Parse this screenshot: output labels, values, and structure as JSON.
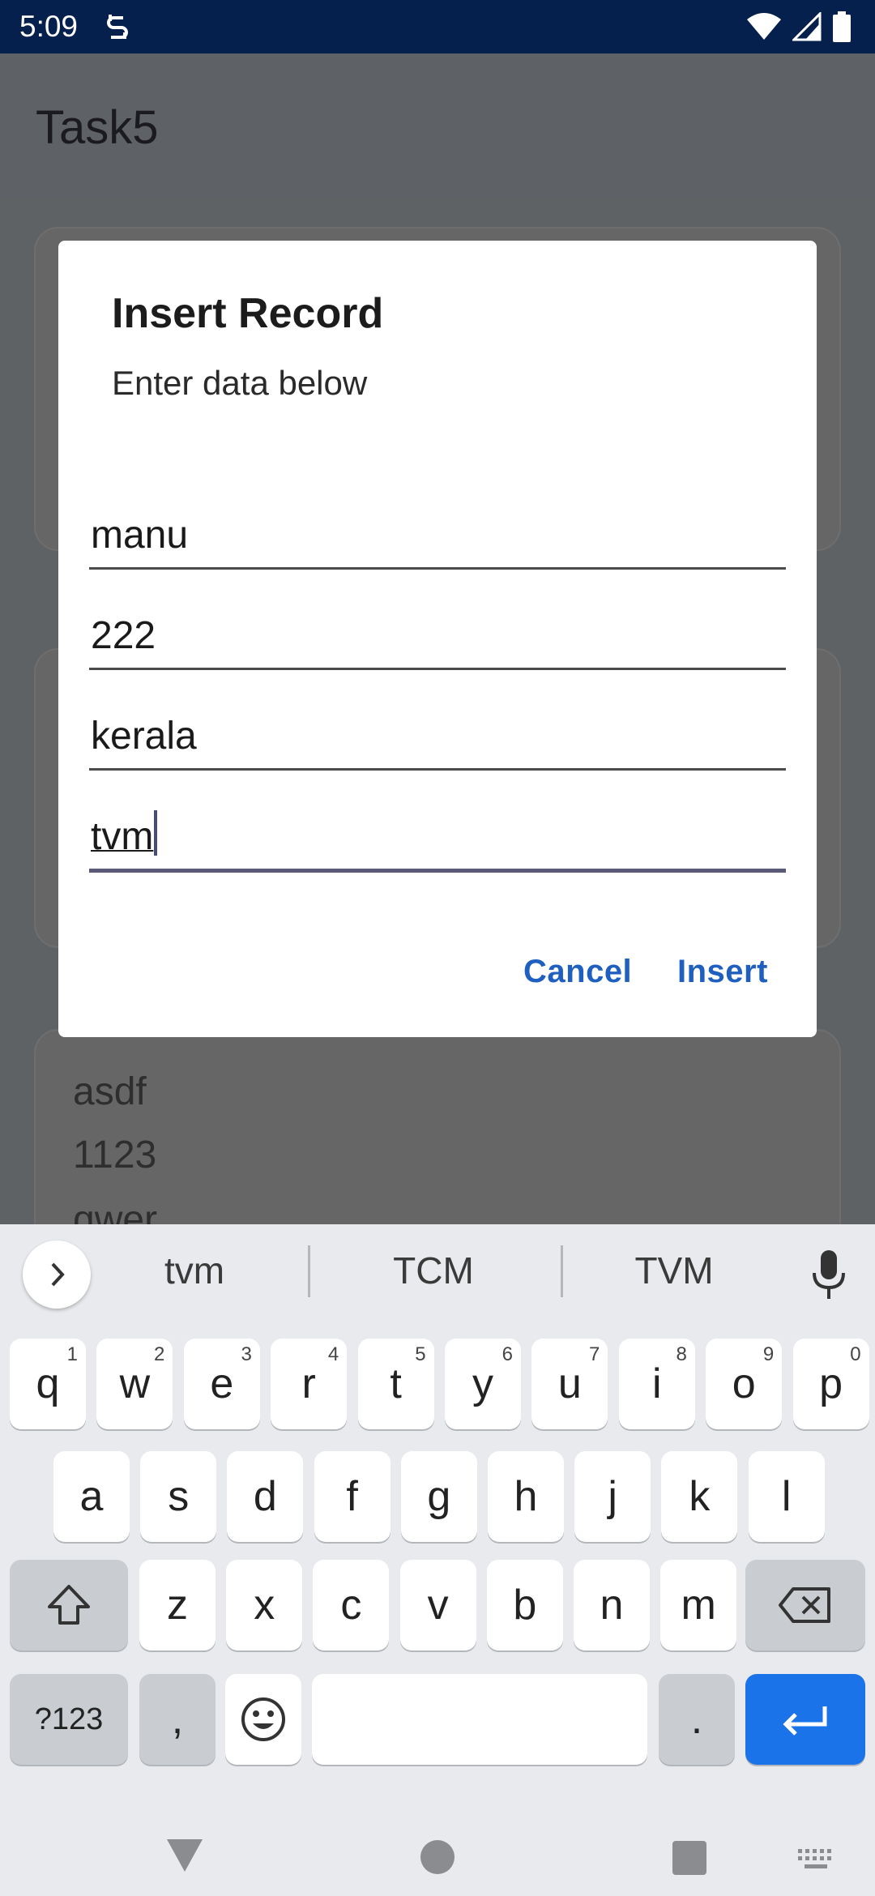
{
  "status": {
    "time": "5:09"
  },
  "app": {
    "title": "Task5"
  },
  "background": {
    "lines": [
      "asdf",
      "1123",
      "qwer"
    ]
  },
  "dialog": {
    "title": "Insert Record",
    "subtitle": "Enter data below",
    "fields": [
      "manu",
      "222",
      "kerala",
      "tvm"
    ],
    "cancel_label": "Cancel",
    "insert_label": "Insert"
  },
  "keyboard": {
    "suggestions": [
      "tvm",
      "TCM",
      "TVM"
    ],
    "row1": [
      {
        "k": "q",
        "h": "1"
      },
      {
        "k": "w",
        "h": "2"
      },
      {
        "k": "e",
        "h": "3"
      },
      {
        "k": "r",
        "h": "4"
      },
      {
        "k": "t",
        "h": "5"
      },
      {
        "k": "y",
        "h": "6"
      },
      {
        "k": "u",
        "h": "7"
      },
      {
        "k": "i",
        "h": "8"
      },
      {
        "k": "o",
        "h": "9"
      },
      {
        "k": "p",
        "h": "0"
      }
    ],
    "row2": [
      "a",
      "s",
      "d",
      "f",
      "g",
      "h",
      "j",
      "k",
      "l"
    ],
    "row3": [
      "z",
      "x",
      "c",
      "v",
      "b",
      "n",
      "m"
    ],
    "symbols_label": "?123",
    "comma_label": ",",
    "period_label": "."
  }
}
